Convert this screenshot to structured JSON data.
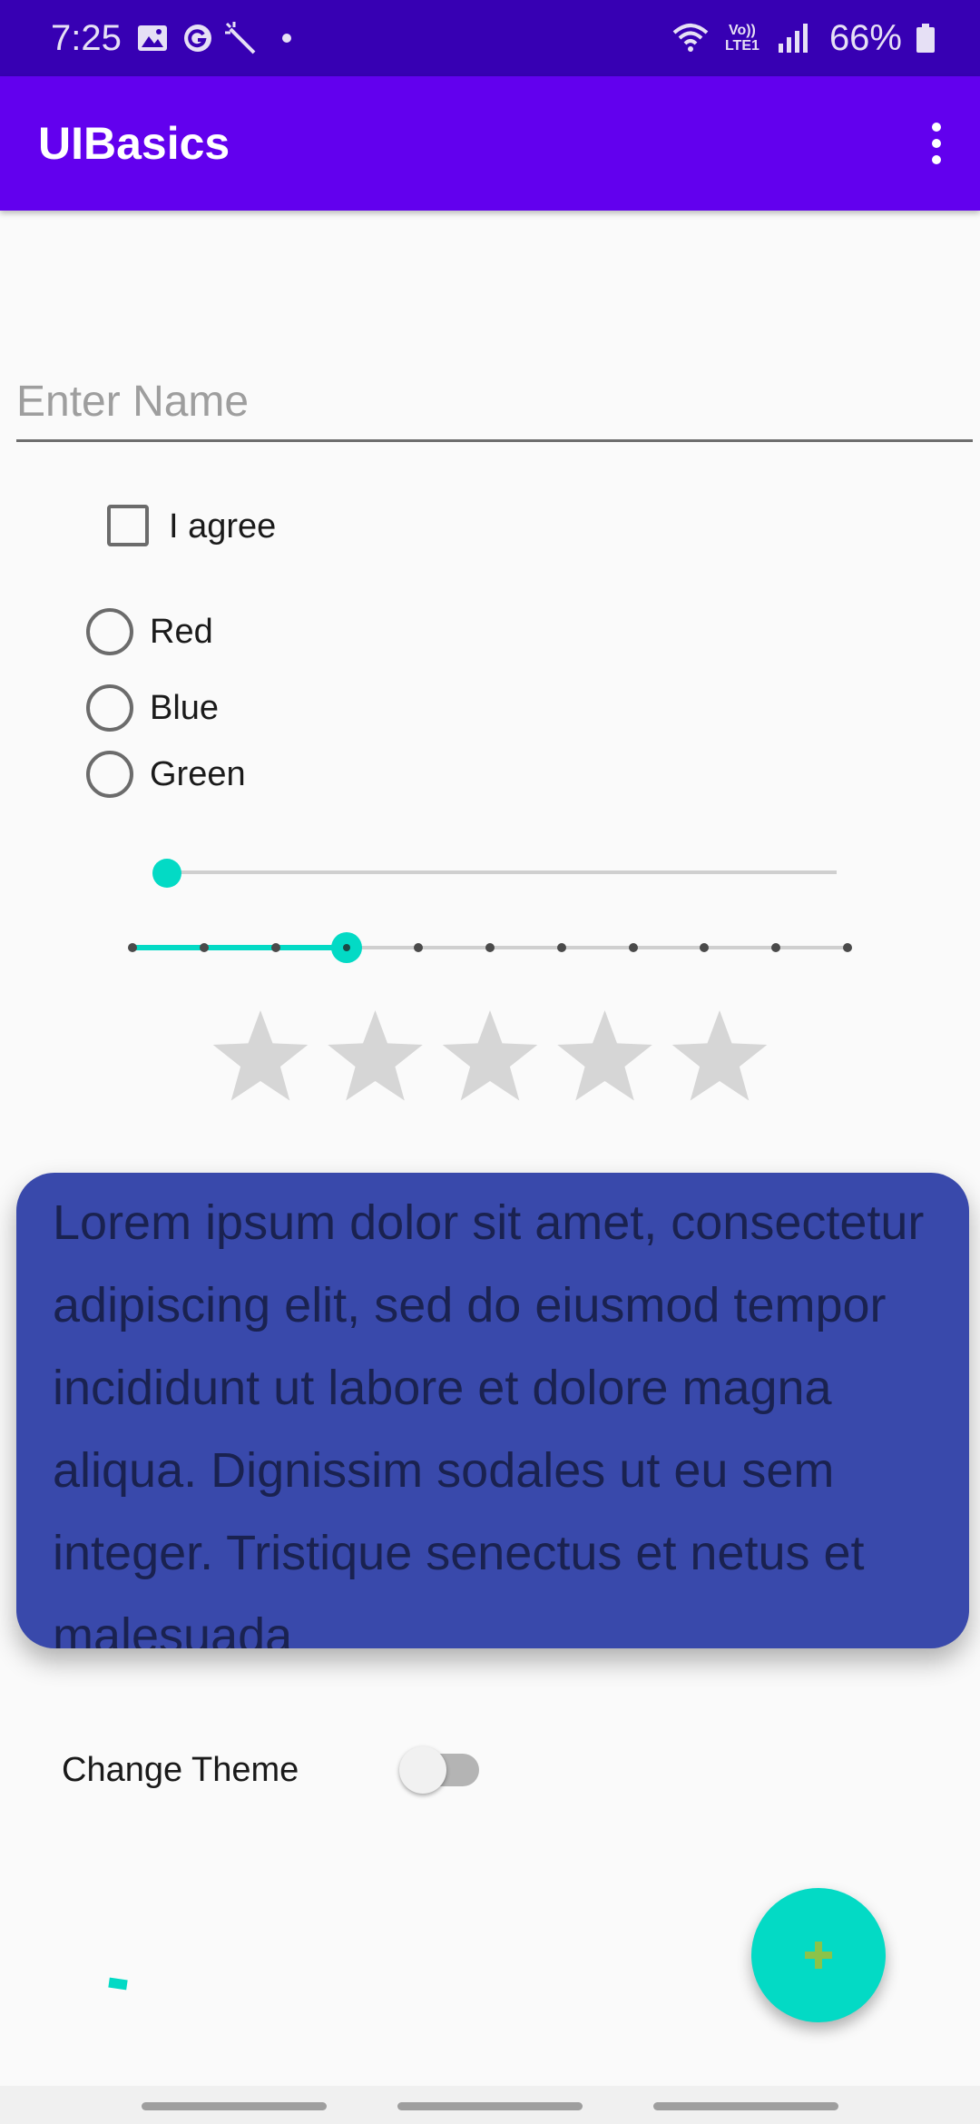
{
  "status_bar": {
    "time": "7:25",
    "battery_text": "66%",
    "network_label": "Vo)) LTE1",
    "icons": [
      "gallery-icon",
      "g-app-icon",
      "magic-wand-icon",
      "dot-icon",
      "wifi-icon",
      "volte-icon",
      "signal-icon",
      "battery-icon"
    ]
  },
  "app_bar": {
    "title": "UIBasics",
    "menu_icon": "overflow-menu-icon"
  },
  "name_input": {
    "placeholder": "Enter Name",
    "value": ""
  },
  "agree_checkbox": {
    "label": "I agree",
    "checked": false
  },
  "color_radios": [
    {
      "label": "Red",
      "selected": false
    },
    {
      "label": "Blue",
      "selected": false
    },
    {
      "label": "Green",
      "selected": false
    }
  ],
  "continuous_slider": {
    "value_fraction": 0.0
  },
  "discrete_slider": {
    "steps": 10,
    "value_step": 3
  },
  "rating_bar": {
    "num_stars": 5,
    "rating": 0
  },
  "card": {
    "text": "Lorem ipsum dolor sit amet, consectetur adipiscing elit, sed do eiusmod tempor incididunt ut labore et dolore magna aliqua. Dignissim sodales ut eu sem integer. Tristique senectus et netus et malesuada"
  },
  "theme_switch": {
    "label": "Change Theme",
    "on": false
  },
  "fab": {
    "icon": "plus-icon"
  },
  "colors": {
    "status_bar": "#3700b3",
    "app_bar": "#6200ee",
    "accent": "#03dac5",
    "card": "#3949ab",
    "card_text": "#1a2250",
    "fab_icon": "#8bc34a",
    "star_empty": "#d6d6d6"
  }
}
